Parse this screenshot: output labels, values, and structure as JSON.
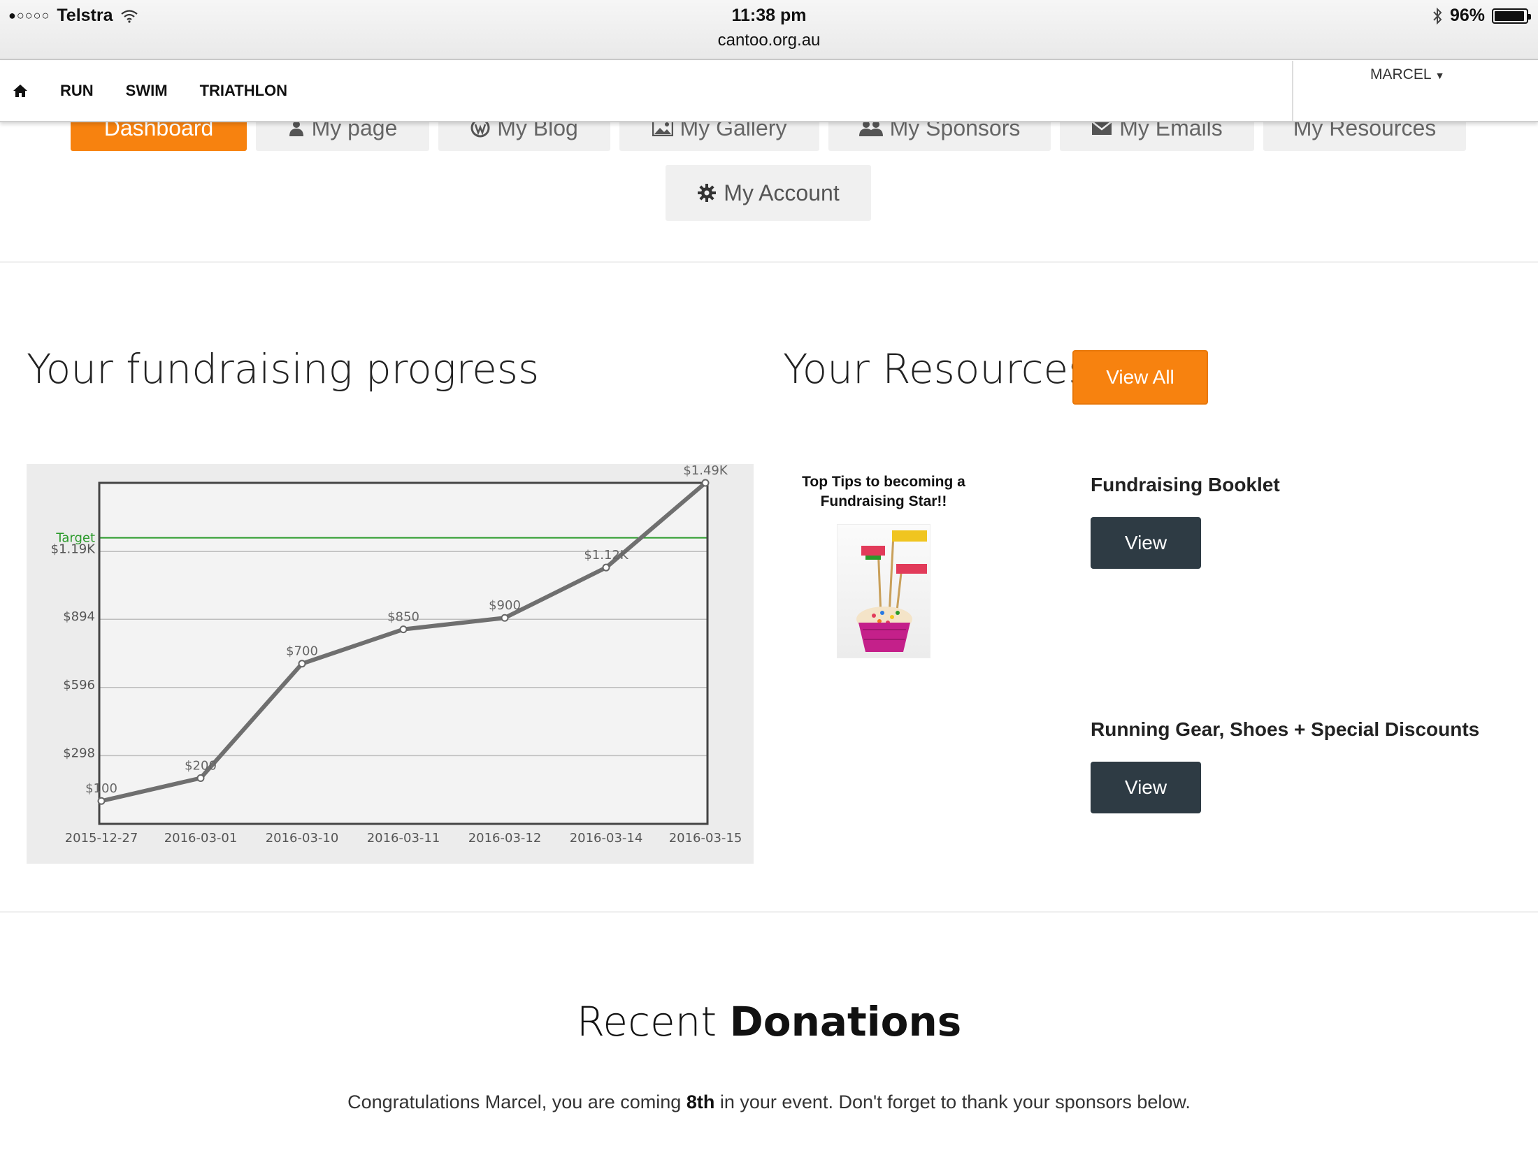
{
  "status_bar": {
    "carrier": "Telstra",
    "signal": "●○○○○",
    "time": "11:38 pm",
    "url": "cantoo.org.au",
    "battery": "96%",
    "battery_level": 0.96
  },
  "top_nav": {
    "items": [
      "RUN",
      "SWIM",
      "TRIATHLON"
    ],
    "user": "MARCEL"
  },
  "tabs": [
    {
      "label": "Dashboard",
      "active": true
    },
    {
      "label": "My page",
      "icon": "user-icon"
    },
    {
      "label": "My Blog",
      "icon": "wordpress-icon"
    },
    {
      "label": "My Gallery",
      "icon": "image-icon"
    },
    {
      "label": "My Sponsors",
      "icon": "users-icon"
    },
    {
      "label": "My Emails",
      "icon": "envelope-icon"
    },
    {
      "label": "My Resources"
    }
  ],
  "account_tab": {
    "label": "My Account",
    "icon": "gear-icon"
  },
  "fundraising": {
    "title": "Your fundraising progress"
  },
  "chart_data": {
    "type": "line",
    "categories": [
      "2015-12-27",
      "2016-03-01",
      "2016-03-10",
      "2016-03-11",
      "2016-03-12",
      "2016-03-14",
      "2016-03-15"
    ],
    "values": [
      100,
      200,
      700,
      850,
      900,
      1120,
      1490
    ],
    "data_labels": [
      "$100",
      "$200",
      "$700",
      "$850",
      "$900",
      "$1.12K",
      "$1.49K"
    ],
    "y_ticks": [
      298,
      596,
      894,
      1190
    ],
    "y_tick_labels": [
      "$298",
      "$596",
      "$894",
      "$1.19K"
    ],
    "ylim": [
      0,
      1490
    ],
    "target": {
      "label": "Target",
      "value": 1250
    },
    "colors": {
      "line": "#6f6f6f",
      "target": "#2a9a2a",
      "plot_bg": "#f3f3f3",
      "grid": "#bdbdbd"
    },
    "grid": true
  },
  "resources": {
    "title": "Your Resources",
    "view_all": "View All",
    "thumb_title_line1": "Top Tips to becoming a",
    "thumb_title_line2": "Fundraising Star!!",
    "items": [
      {
        "title": "Fundraising Booklet",
        "button": "View"
      },
      {
        "title": "Running Gear, Shoes + Special Discounts",
        "button": "View"
      }
    ]
  },
  "donations": {
    "title_light": "Recent",
    "title_bold": "Donations",
    "message_before": "Congratulations Marcel, you are coming",
    "rank": "8th",
    "message_after": "in your event. Don't forget to thank your sponsors below."
  },
  "colors": {
    "accent": "#f7820f",
    "dark_button": "#2e3b44"
  }
}
